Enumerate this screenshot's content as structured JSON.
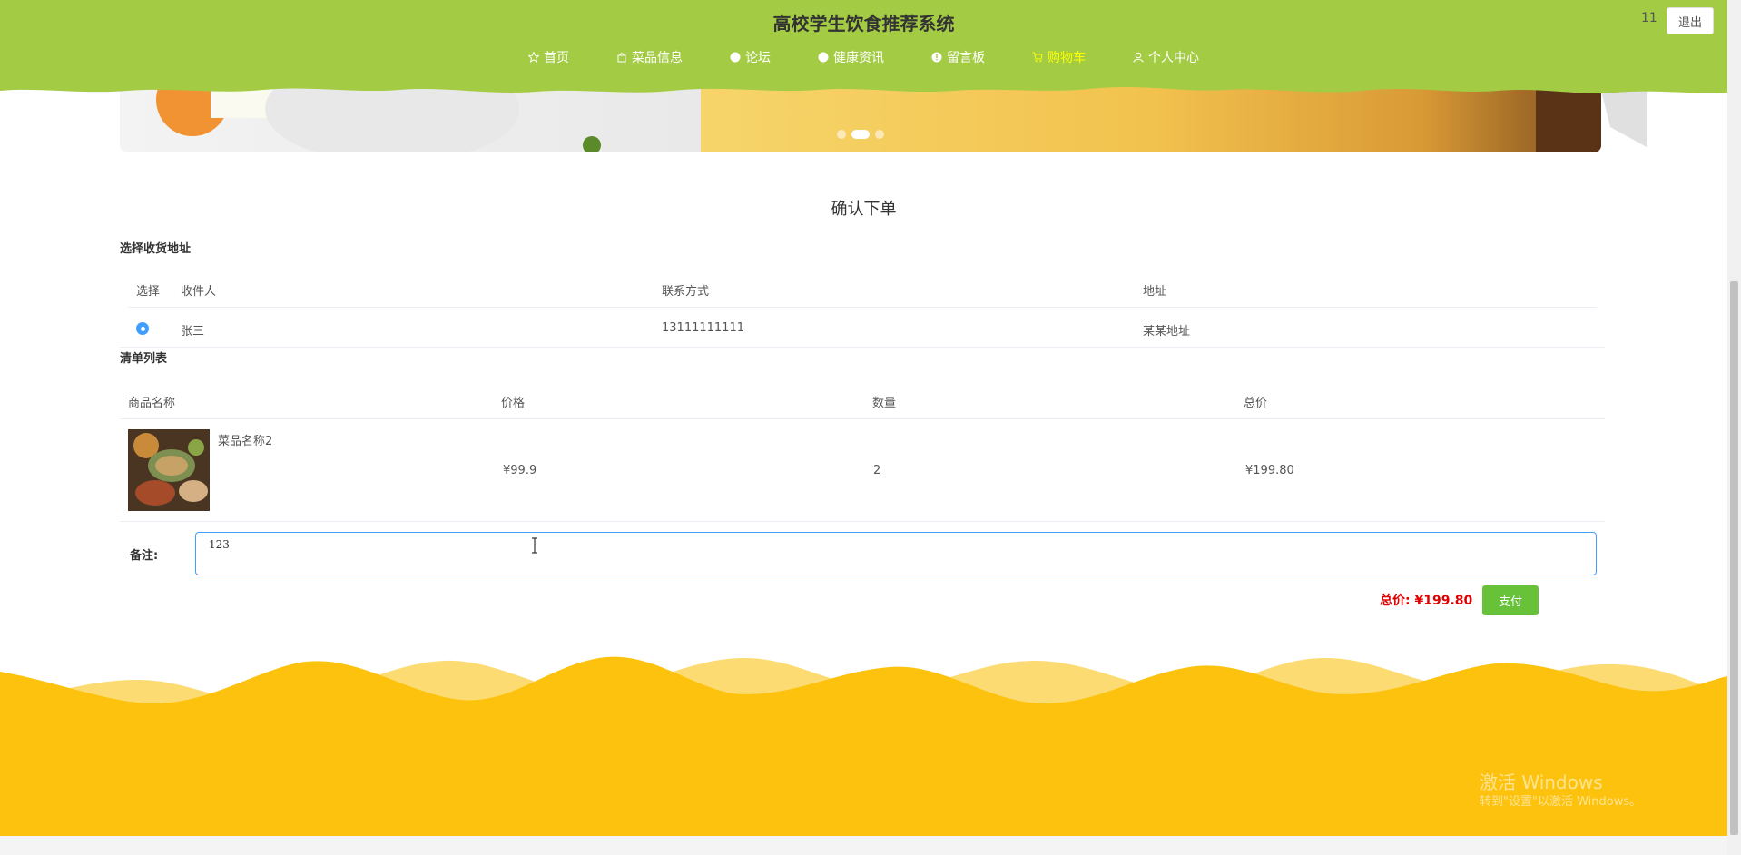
{
  "header": {
    "title": "高校学生饮食推荐系统",
    "user_name": "11",
    "logout_label": "退出",
    "bg_color": "#a3cb44",
    "nav": [
      {
        "label": "首页",
        "icon": "star-icon"
      },
      {
        "label": "菜品信息",
        "icon": "shop-icon"
      },
      {
        "label": "论坛",
        "icon": "info-circle-icon"
      },
      {
        "label": "健康资讯",
        "icon": "info-circle-icon"
      },
      {
        "label": "留言板",
        "icon": "info-circle-icon"
      },
      {
        "label": "购物车",
        "icon": "cart-icon",
        "active": true
      },
      {
        "label": "个人中心",
        "icon": "user-icon"
      }
    ]
  },
  "banner": {
    "active_slide": 2,
    "slide_count": 3
  },
  "page": {
    "title": "确认下单"
  },
  "address": {
    "section_title": "选择收货地址",
    "columns": [
      "选择",
      "收件人",
      "联系方式",
      "地址"
    ],
    "rows": [
      {
        "recipient": "张三",
        "phone": "13111111111",
        "address": "某某地址",
        "selected": true
      }
    ]
  },
  "order_list": {
    "section_title": "清单列表",
    "columns": [
      "商品名称",
      "价格",
      "数量",
      "总价"
    ],
    "rows": [
      {
        "name": "菜品名称2",
        "price": "¥99.9",
        "quantity": "2",
        "total": "¥199.80"
      }
    ]
  },
  "remark": {
    "label": "备注:",
    "value": "123"
  },
  "summary": {
    "total_label": "总价:",
    "total_value": "¥199.80",
    "pay_label": "支付"
  },
  "watermark": {
    "line1": "激活 Windows",
    "line2": "转到\"设置\"以激活 Windows。"
  },
  "colors": {
    "accent": "#409eff",
    "pay": "#67c23a",
    "footer_wave": "#fcc20d",
    "price_red": "#e00000"
  }
}
